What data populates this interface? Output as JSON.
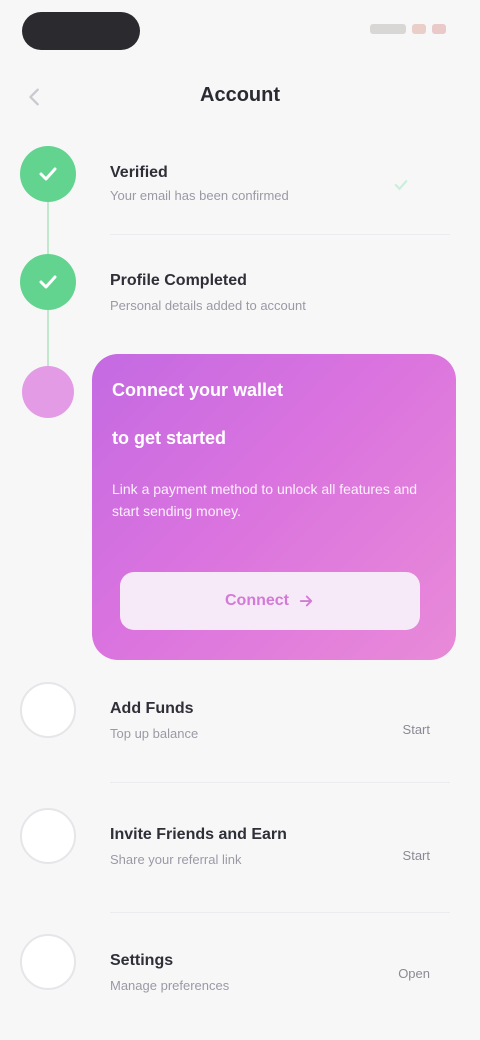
{
  "header": {
    "title": "Account",
    "back_icon": "chevron-left-icon"
  },
  "colors": {
    "done": "#63d48f",
    "active_gradient_start": "#c46ae2",
    "active_gradient_end": "#e98ad8",
    "background": "#f7f7f8"
  },
  "steps_done": [
    {
      "title": "Verified",
      "subtitle": "Your email has been confirmed",
      "status_icon": "check-icon"
    },
    {
      "title": "Profile Completed",
      "subtitle": "Personal details added to account",
      "status_icon": "check-icon"
    }
  ],
  "active_card": {
    "title_line1": "Connect your wallet",
    "title_line2": "to get started",
    "description": "Link a payment method to unlock all features and start sending money.",
    "button_label": "Connect",
    "button_icon": "arrow-right-icon"
  },
  "steps_todo": [
    {
      "title": "Add Funds",
      "subtitle": "Top up balance",
      "action": "Start"
    },
    {
      "title": "Invite Friends and Earn",
      "subtitle": "Share your referral link",
      "action": "Start"
    },
    {
      "title": "Settings",
      "subtitle": "Manage preferences",
      "action": "Open"
    }
  ]
}
